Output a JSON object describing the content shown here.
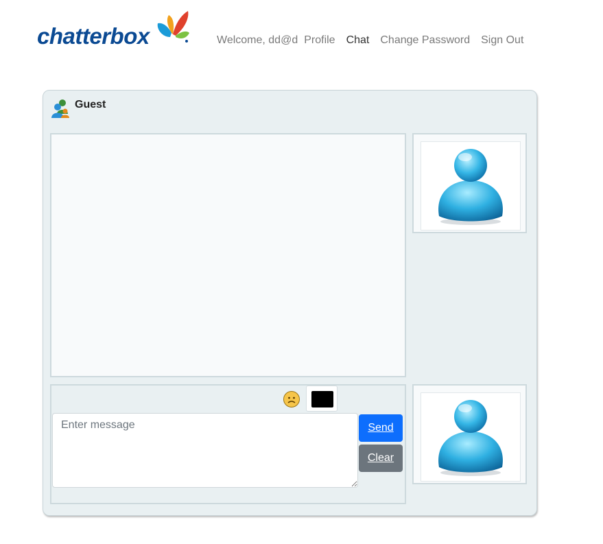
{
  "app": {
    "brand": "chatterbox"
  },
  "nav": {
    "welcome": "Welcome, dd@d",
    "items": [
      {
        "label": "Profile",
        "active": false
      },
      {
        "label": "Chat",
        "active": true
      },
      {
        "label": "Change Password",
        "active": false
      },
      {
        "label": "Sign Out",
        "active": false
      }
    ]
  },
  "chat": {
    "contact_name": "Guest",
    "contact_icon": "messenger-users-icon",
    "message_placeholder": "Enter message",
    "message_value": "",
    "emoji_icon": "emoji-icon",
    "font_color": "#000000",
    "send_label": "Send",
    "clear_label": "Clear",
    "remote_avatar_icon": "user-avatar-icon",
    "local_avatar_icon": "user-avatar-icon"
  },
  "colors": {
    "brand": "#0b4a93",
    "primary": "#0d6efd",
    "secondary": "#6c757d",
    "panel_bg": "#e9f0f2"
  }
}
